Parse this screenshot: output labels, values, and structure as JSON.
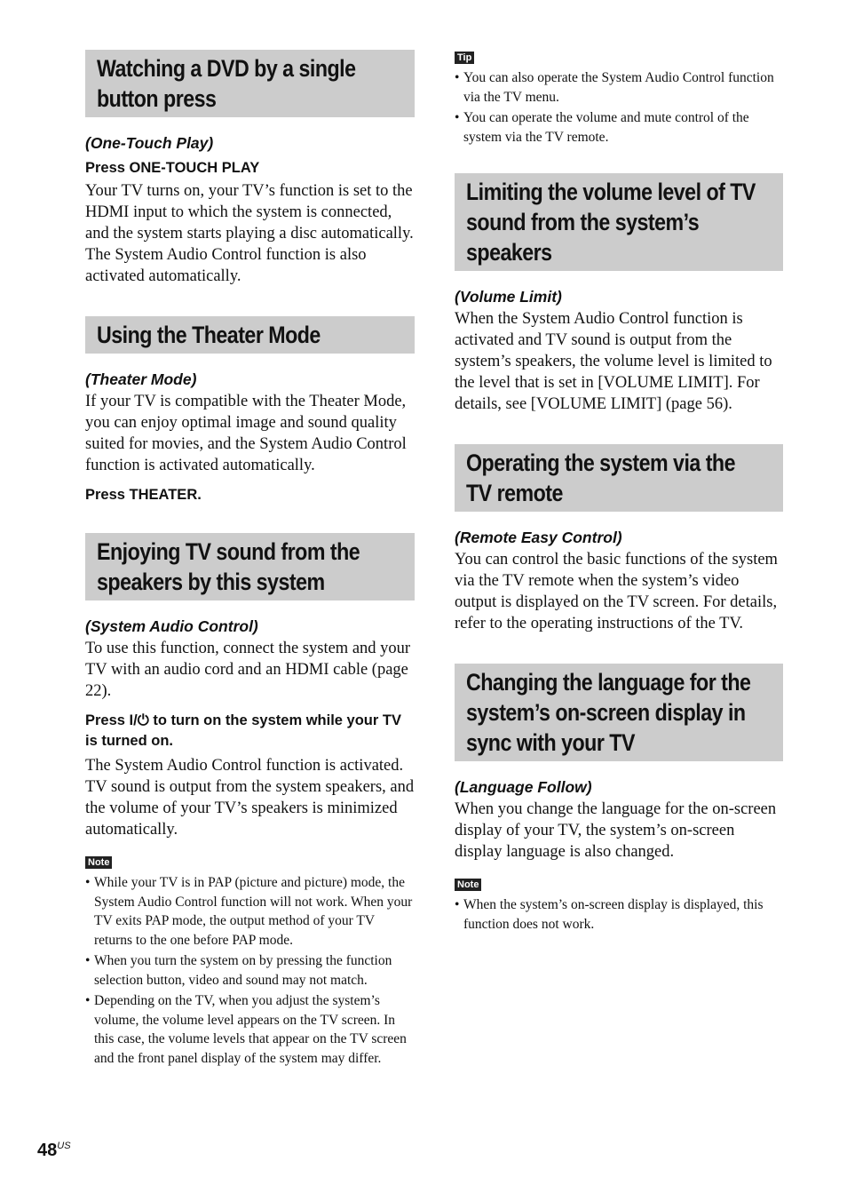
{
  "left": {
    "s1": {
      "heading": [
        "Watching a DVD by a single",
        "button press"
      ],
      "subtitle": "(One-Touch Play)",
      "press": "Press ONE-TOUCH PLAY",
      "body": [
        "Your TV turns on, your TV’s function is set to the HDMI input to which the system is connected, and the system starts playing a disc automatically.",
        "The System Audio Control function is also activated automatically."
      ]
    },
    "s2": {
      "heading": [
        "Using the Theater Mode"
      ],
      "subtitle": "(Theater Mode)",
      "body": "If your TV is compatible with the Theater Mode, you can enjoy optimal image and sound quality suited for movies, and the System Audio Control function is activated automatically.",
      "press": "Press THEATER."
    },
    "s3": {
      "heading": [
        "Enjoying TV sound from the",
        "speakers by this system"
      ],
      "subtitle": "(System Audio Control)",
      "body1": "To use this function, connect the system and your TV with an audio cord and an HDMI cable (page 22).",
      "press_pre": "Press ",
      "press_icon": "I/⏻",
      "press_post": " to turn on the system while your TV is turned on.",
      "body2": "The System Audio Control function is activated. TV sound is output from the system speakers, and the volume of your TV’s speakers is minimized automatically.",
      "note_label": "Note",
      "notes": [
        "While your TV is in PAP (picture and picture) mode, the System Audio Control function will not work. When your TV exits PAP mode, the output method of your TV returns to the one before PAP mode.",
        "When you turn the system on by pressing the function selection button, video and sound may not match.",
        "Depending on the TV, when you adjust the system’s volume, the volume level appears on the TV screen. In this case, the volume levels that appear on the TV screen and the front panel display of the system may differ."
      ]
    }
  },
  "right": {
    "tip": {
      "label": "Tip",
      "items": [
        "You can also operate the System Audio Control function via the TV menu.",
        "You can operate the volume and mute control of the system via the TV remote."
      ]
    },
    "s4": {
      "heading": [
        "Limiting the volume level of TV",
        "sound from the system’s",
        "speakers"
      ],
      "subtitle": "(Volume Limit)",
      "body": "When the System Audio Control function is activated and TV sound is output from the system’s speakers, the volume level is limited to the level that is set in [VOLUME LIMIT]. For details, see [VOLUME LIMIT] (page 56)."
    },
    "s5": {
      "heading": [
        "Operating the system via the",
        "TV remote"
      ],
      "subtitle": "(Remote Easy Control)",
      "body": "You can control the basic functions of the system via the TV remote when the system’s video output is displayed on the TV screen. For details, refer to the operating instructions of the TV."
    },
    "s6": {
      "heading": [
        "Changing the language for the",
        "system’s on-screen display in",
        "sync with your TV"
      ],
      "subtitle": "(Language Follow)",
      "body": "When you change the language for the on-screen display of your TV, the system’s on-screen display language is also changed.",
      "note_label": "Note",
      "notes": [
        "When the system’s on-screen display is displayed, this function does not work."
      ]
    }
  },
  "footer": {
    "page": "48",
    "region": "US"
  },
  "bullet": "•"
}
